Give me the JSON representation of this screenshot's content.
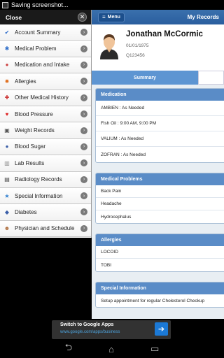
{
  "status_bar": {
    "text": "Saving screenshot..."
  },
  "sidebar": {
    "title": "Close",
    "items": [
      {
        "label": "Account Summary",
        "icon": "check-icon",
        "color": "#2c6cc9"
      },
      {
        "label": "Medical Problem",
        "icon": "star-of-life-icon",
        "color": "#2c6cc9"
      },
      {
        "label": "Medication and Intake",
        "icon": "pill-icon",
        "color": "#c44"
      },
      {
        "label": "Allergies",
        "icon": "allergy-icon",
        "color": "#e07020"
      },
      {
        "label": "Other Medical History",
        "icon": "medical-bag-icon",
        "color": "#c33"
      },
      {
        "label": "Blood Pressure",
        "icon": "heart-icon",
        "color": "#d22"
      },
      {
        "label": "Weight Records",
        "icon": "scale-icon",
        "color": "#555"
      },
      {
        "label": "Blood Sugar",
        "icon": "blood-drop-icon",
        "color": "#3a5ea8"
      },
      {
        "label": "Lab Results",
        "icon": "lab-icon",
        "color": "#888"
      },
      {
        "label": "Radiology Records",
        "icon": "xray-icon",
        "color": "#444"
      },
      {
        "label": "Special Information",
        "icon": "star-icon",
        "color": "#2f7fd0"
      },
      {
        "label": "Diabetes",
        "icon": "diabetes-icon",
        "color": "#3a5ea8"
      },
      {
        "label": "Physician and Schedule",
        "icon": "physician-icon",
        "color": "#b07040"
      }
    ]
  },
  "header": {
    "menu_label": "Menu",
    "title": "My Records"
  },
  "profile": {
    "name": "Jonathan McCormic",
    "dob": "01/01/1975",
    "id": "Q123456"
  },
  "tabs": {
    "summary": "Summary"
  },
  "medication": {
    "title": "Medication",
    "rows": [
      "AMBIEN : As Needed",
      "Fish Oil : 9:00 AM, 9:00 PM",
      "VALIUM : As Needed",
      "ZOFRAN : As Needed"
    ]
  },
  "problems": {
    "title": "Medical Problems",
    "rows": [
      "Back Pain",
      "Headache",
      "Hydrocephalus"
    ]
  },
  "allergies": {
    "title": "Allergies",
    "rows": [
      "LOCOID",
      "TOBI"
    ]
  },
  "special": {
    "title": "Special Information",
    "rows": [
      "Setup appointment for regular Cholesterol Checkup"
    ]
  },
  "ad": {
    "title": "Switch to Google Apps",
    "url": "www.google.com/apps/business"
  }
}
